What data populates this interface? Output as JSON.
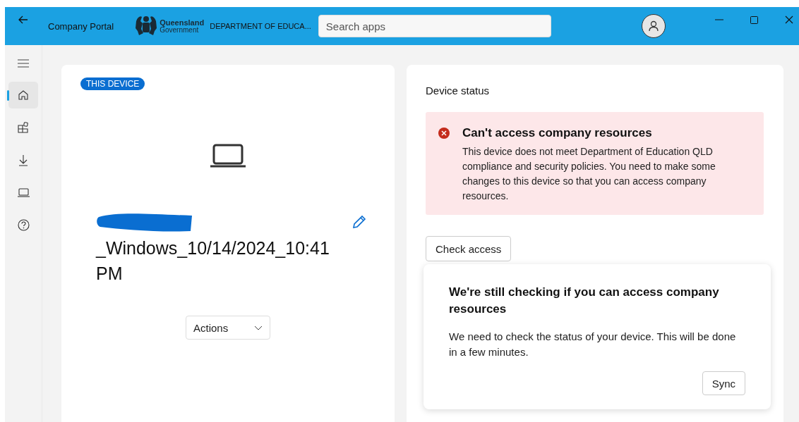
{
  "window": {
    "title": "Company Portal"
  },
  "header": {
    "org_name": "Queensland",
    "org_sub": "Government",
    "department": "DEPARTMENT OF EDUCA...",
    "search": {
      "placeholder": "Search apps"
    }
  },
  "sidebar": {
    "items": [
      {
        "kind": "home",
        "selected": true
      },
      {
        "kind": "apps",
        "selected": false
      },
      {
        "kind": "downloads",
        "selected": false
      },
      {
        "kind": "devices",
        "selected": false
      },
      {
        "kind": "help",
        "selected": false
      }
    ]
  },
  "device": {
    "badge": "THIS DEVICE",
    "name": "_Windows_10/14/2024_10:41 PM",
    "actions": "Actions"
  },
  "status": {
    "title": "Device status",
    "alert": {
      "title": "Can't access company resources",
      "body": "This device does not meet Department of Education QLD compliance and security policies. You need to make some changes to this device so that you can access company resources."
    },
    "check_button": "Check access",
    "popup": {
      "title": "We're still checking if you can access company resources",
      "body": "We need to check the status of your device. This will be done in a few minutes.",
      "button": "Sync"
    }
  }
}
